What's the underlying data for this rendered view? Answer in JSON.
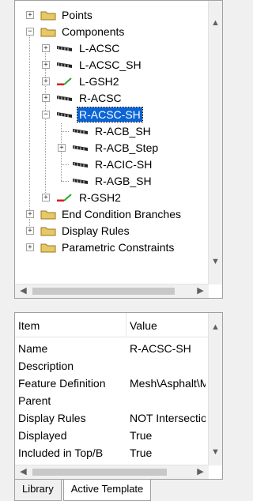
{
  "tree": {
    "items": [
      {
        "label": "Points",
        "type": "folder",
        "expander": "+"
      },
      {
        "label": "Components",
        "type": "folder",
        "expander": "-"
      },
      {
        "label": "L-ACSC",
        "type": "comp",
        "expander": "+"
      },
      {
        "label": "L-ACSC_SH",
        "type": "comp",
        "expander": "+"
      },
      {
        "label": "L-GSH2",
        "type": "shoulder",
        "expander": "+"
      },
      {
        "label": "R-ACSC",
        "type": "comp",
        "expander": "+"
      },
      {
        "label": "R-ACSC-SH",
        "type": "comp",
        "expander": "-",
        "selected": true
      },
      {
        "label": "R-ACB_SH",
        "type": "comp",
        "expander": ""
      },
      {
        "label": "R-ACB_Step",
        "type": "comp",
        "expander": "+"
      },
      {
        "label": "R-ACIC-SH",
        "type": "comp",
        "expander": ""
      },
      {
        "label": "R-AGB_SH",
        "type": "comp",
        "expander": ""
      },
      {
        "label": "R-GSH2",
        "type": "shoulder",
        "expander": "+"
      },
      {
        "label": "End Condition Branches",
        "type": "folder",
        "expander": "+"
      },
      {
        "label": "Display Rules",
        "type": "folder",
        "expander": "+"
      },
      {
        "label": "Parametric Constraints",
        "type": "folder",
        "expander": "+"
      }
    ]
  },
  "grid": {
    "header": {
      "item": "Item",
      "value": "Value"
    },
    "rows": [
      {
        "item": "Name",
        "value": "R-ACSC-SH"
      },
      {
        "item": "Description",
        "value": ""
      },
      {
        "item": "Feature Definition",
        "value": "Mesh\\Asphalt\\M"
      },
      {
        "item": "Parent",
        "value": ""
      },
      {
        "item": "Display Rules",
        "value": "NOT Intersection"
      },
      {
        "item": "Displayed",
        "value": "True"
      },
      {
        "item": "Included in Top/B",
        "value": "True"
      }
    ]
  },
  "tabs": [
    {
      "label": "Library",
      "active": false
    },
    {
      "label": "Active Template",
      "active": true
    }
  ],
  "icons": {
    "scroll_up": "▲",
    "scroll_down": "▼",
    "scroll_left": "◀",
    "scroll_right": "▶"
  },
  "colors": {
    "selection": "#0a64d6",
    "folder": "#e8c765",
    "shoulder_red": "#d81e1e",
    "shoulder_green": "#2aa82a"
  }
}
